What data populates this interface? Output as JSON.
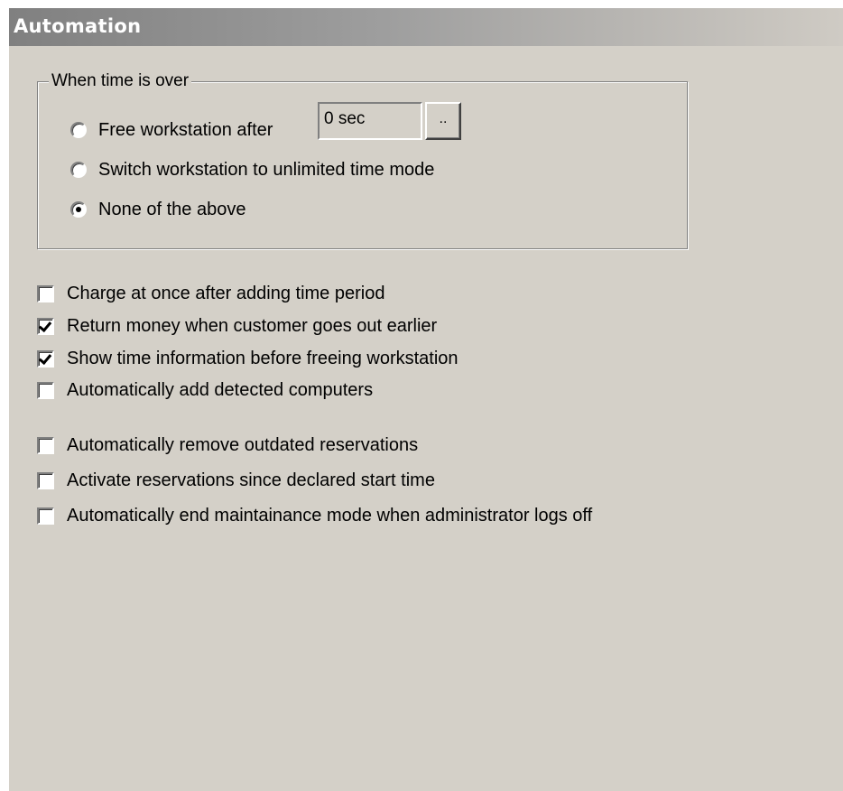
{
  "header": {
    "title": "Automation"
  },
  "time_over_group": {
    "legend": "When time is over",
    "options": [
      {
        "label": "Free workstation after",
        "selected": false
      },
      {
        "label": "Switch workstation to unlimited time mode",
        "selected": false
      },
      {
        "label": "None of the above",
        "selected": true
      }
    ],
    "duration_value": "0 sec",
    "duration_button_label": ".."
  },
  "options_group1": [
    {
      "label": "Charge at once after adding time period",
      "checked": false
    },
    {
      "label": "Return money when customer goes out earlier",
      "checked": true
    },
    {
      "label": "Show time information before freeing workstation",
      "checked": true
    },
    {
      "label": "Automatically add detected computers",
      "checked": false
    }
  ],
  "options_group2": [
    {
      "label": "Automatically remove outdated reservations",
      "checked": false
    },
    {
      "label": "Activate reservations since declared start time",
      "checked": false
    },
    {
      "label": "Automatically end maintainance mode when administrator logs off",
      "checked": false
    }
  ]
}
